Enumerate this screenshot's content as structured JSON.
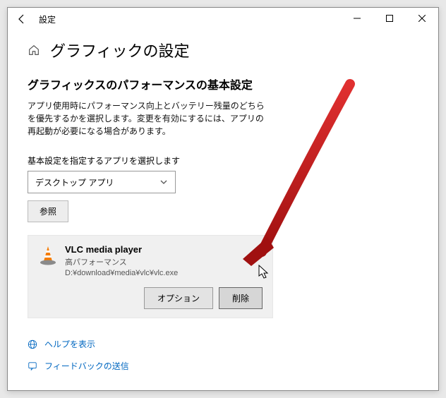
{
  "title": "設定",
  "heading": "グラフィックの設定",
  "subheading": "グラフィックスのパフォーマンスの基本設定",
  "description": "アプリ使用時にパフォーマンス向上とバッテリー残量のどちらを優先するかを選択します。変更を有効にするには、アプリの再起動が必要になる場合があります。",
  "field_label": "基本設定を指定するアプリを選択します",
  "combo_value": "デスクトップ アプリ",
  "browse_label": "参照",
  "app": {
    "name": "VLC media player",
    "mode": "高パフォーマンス",
    "path": "D:¥download¥media¥vlc¥vlc.exe"
  },
  "btn_options": "オプション",
  "btn_remove": "削除",
  "links": {
    "help": "ヘルプを表示",
    "feedback": "フィードバックの送信"
  }
}
